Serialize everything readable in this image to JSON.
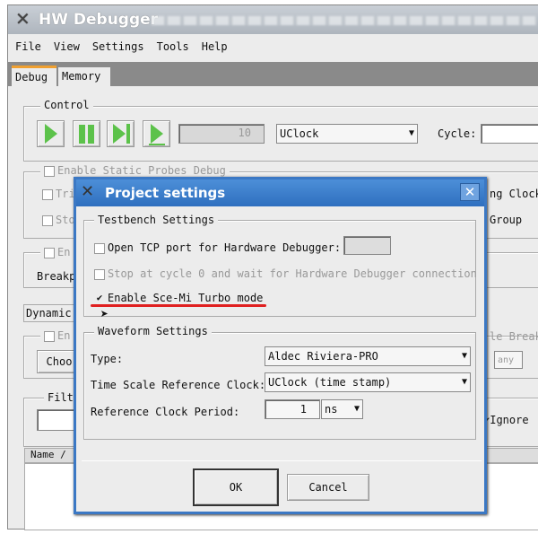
{
  "window": {
    "title": "HW Debugger"
  },
  "menu": [
    "File",
    "View",
    "Settings",
    "Tools",
    "Help"
  ],
  "tabs": [
    "Debug",
    "Memory"
  ],
  "control": {
    "label": "Control",
    "spinner_value": "10",
    "clock": "UClock",
    "cycle_label": "Cycle:"
  },
  "static": {
    "label": "Enable Static Probes Debug",
    "tri": "Tri",
    "sto": "Sto",
    "clock_right": "ng Clock",
    "group_right": "Group"
  },
  "group3": {
    "en": "En",
    "breakp": "Breakp"
  },
  "dynamic": {
    "tab": "Dynamic",
    "en": "En",
    "choose": "Choo",
    "right": "le Break",
    "any": "any"
  },
  "filter": {
    "label": "Filte",
    "ignore": "Ignore"
  },
  "table": {
    "name_col": "Name /"
  },
  "dialog": {
    "title": "Project settings",
    "testbench": {
      "label": "Testbench Settings",
      "open_tcp": "Open TCP port for Hardware Debugger:",
      "stop_cycle": "Stop at cycle 0 and wait for Hardware Debugger connection",
      "turbo": "Enable Sce-Mi Turbo mode",
      "turbo_checked": true
    },
    "waveform": {
      "label": "Waveform Settings",
      "type_label": "Type:",
      "type_value": "Aldec Riviera-PRO",
      "ts_label": "Time Scale Reference Clock:",
      "ts_value": "UClock (time stamp)",
      "period_label": "Reference Clock Period:",
      "period_value": "1",
      "period_unit": "ns"
    },
    "ok": "OK",
    "cancel": "Cancel"
  },
  "colors": {
    "dialog_title": "#3b78c4",
    "highlight": "#e02020",
    "play": "#5cc24a"
  }
}
